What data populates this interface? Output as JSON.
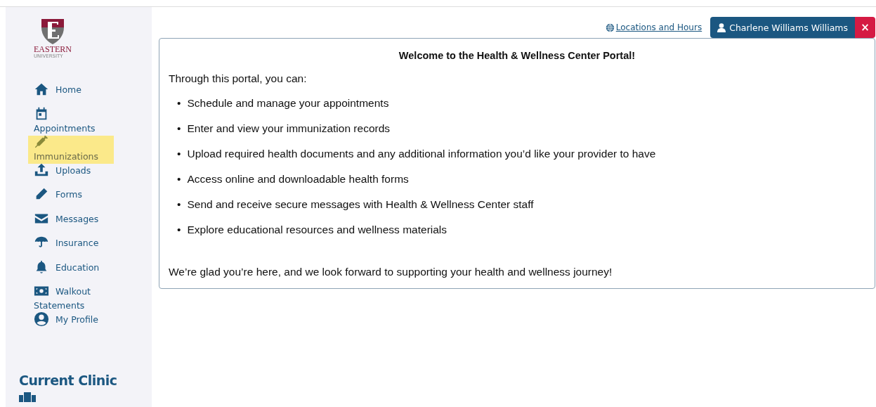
{
  "logo": {
    "name": "EASTERN",
    "subtitle": "UNIVERSITY"
  },
  "nav": [
    {
      "label": "Home",
      "highlighted": false
    },
    {
      "label": "Appointments",
      "highlighted": false
    },
    {
      "label": "Immunizations",
      "highlighted": true
    },
    {
      "label": "Uploads",
      "highlighted": false
    },
    {
      "label": "Forms",
      "highlighted": false
    },
    {
      "label": "Messages",
      "highlighted": false
    },
    {
      "label": "Insurance",
      "highlighted": false
    },
    {
      "label": "Education",
      "highlighted": false
    },
    {
      "label": "Walkout Statements",
      "highlighted": false
    },
    {
      "label": "My Profile",
      "highlighted": false
    }
  ],
  "current_clinic": {
    "heading": "Current Clinic"
  },
  "header": {
    "locations_link": "Locations and Hours",
    "user": "Charlene Williams Williams",
    "close": "×"
  },
  "welcome": {
    "title": "Welcome to the Health & Wellness Center Portal!",
    "intro": "Through this portal, you can:",
    "bullets": [
      {
        "marker": "•",
        "text": "Schedule and manage your appointments"
      },
      {
        "marker": "•",
        "text": "Enter and view your immunization records"
      },
      {
        "marker": "•",
        "text": "Upload required health documents and any additional information you’d like your provider to have"
      },
      {
        "marker": "•",
        "text": "Access online and downloadable health forms"
      },
      {
        "marker": "•",
        "text": "Send and receive secure messages with Health & Wellness Center staff"
      },
      {
        "marker": "•",
        "text": "Explore educational resources and wellness materials"
      }
    ],
    "closing": "We’re glad you’re here, and we look forward to supporting your health and wellness journey!"
  }
}
